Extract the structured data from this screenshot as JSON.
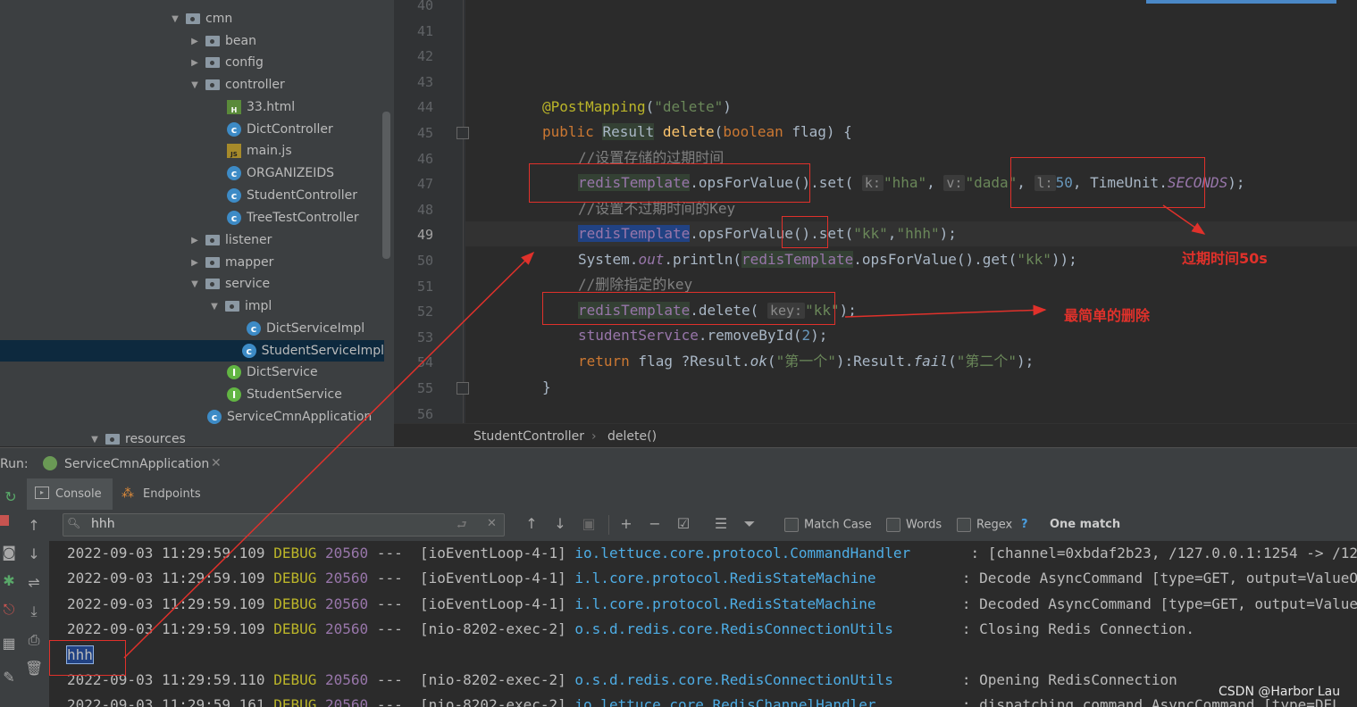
{
  "tree": {
    "items": [
      {
        "label": "cmn",
        "type": "folder",
        "expanded": true
      },
      {
        "label": "bean",
        "type": "folder",
        "expanded": false
      },
      {
        "label": "config",
        "type": "folder",
        "expanded": false
      },
      {
        "label": "controller",
        "type": "folder",
        "expanded": true
      },
      {
        "label": "33.html",
        "type": "html"
      },
      {
        "label": "DictController",
        "type": "class"
      },
      {
        "label": "main.js",
        "type": "js"
      },
      {
        "label": "ORGANIZEIDS",
        "type": "class"
      },
      {
        "label": "StudentController",
        "type": "class"
      },
      {
        "label": "TreeTestController",
        "type": "class"
      },
      {
        "label": "listener",
        "type": "folder",
        "expanded": false
      },
      {
        "label": "mapper",
        "type": "folder",
        "expanded": false
      },
      {
        "label": "service",
        "type": "folder",
        "expanded": true
      },
      {
        "label": "impl",
        "type": "folder",
        "expanded": true
      },
      {
        "label": "DictServiceImpl",
        "type": "class"
      },
      {
        "label": "StudentServiceImpl",
        "type": "class",
        "selected": true
      },
      {
        "label": "DictService",
        "type": "interface"
      },
      {
        "label": "StudentService",
        "type": "interface"
      },
      {
        "label": "ServiceCmnApplication",
        "type": "app"
      },
      {
        "label": "resources",
        "type": "folder",
        "expanded": true
      }
    ]
  },
  "editor": {
    "line_numbers": [
      "40",
      "41",
      "42",
      "43",
      "44",
      "45",
      "46",
      "47",
      "48",
      "49",
      "50",
      "51",
      "52",
      "53",
      "54",
      "55",
      "56"
    ],
    "current_line": "49",
    "code": {
      "l44_ann": "@PostMapping",
      "l44_p1": "(",
      "l44_str": "\"delete\"",
      "l44_p2": ")",
      "l45_kw1": "public ",
      "l45_type": "Result",
      "l45_sp": " ",
      "l45_fn": "delete",
      "l45_p1": "(",
      "l45_kw2": "boolean",
      "l45_rest": " flag) {",
      "l46": "//设置存储的过期时间",
      "l47_obj": "redisTemplate",
      "l47_m": ".opsForValue().set(",
      "l47_h1": "k:",
      "l47_s1": "\"hha\"",
      "l47_c1": ", ",
      "l47_h2": "v:",
      "l47_s2": "\"dada\"",
      "l47_c2": ", ",
      "l47_h3": "l:",
      "l47_n": "50",
      "l47_t": ", TimeUnit.",
      "l47_f": "SECONDS",
      "l47_end": ");",
      "l48": "//设置不过期时间的Key",
      "l49_obj": "redisTemplate",
      "l49_m": ".opsForValue()",
      "l49_set": ".set(",
      "l49_s1": "\"kk\"",
      "l49_c": ",",
      "l49_s2": "\"hhh\"",
      "l49_end": ");",
      "l50_a": "System.",
      "l50_out": "out",
      "l50_b": ".println(",
      "l50_obj": "redisTemplate",
      "l50_c": ".opsForValue().get(",
      "l50_s": "\"kk\"",
      "l50_end": "));",
      "l51": "//删除指定的key",
      "l52_obj": "redisTemplate",
      "l52_m": ".delete(",
      "l52_h": "key:",
      "l52_s": "\"kk\"",
      "l52_end": ");",
      "l53_f": "studentService",
      "l53_m": ".removeById(",
      "l53_n": "2",
      "l53_end": ");",
      "l54_kw": "return",
      "l54_a": " flag ?Result.",
      "l54_ok": "ok",
      "l54_p1": "(",
      "l54_s1": "\"第一个\"",
      "l54_b": "):Result.",
      "l54_fail": "fail",
      "l54_p2": "(",
      "l54_s2": "\"第二个\"",
      "l54_end": ");",
      "l55": "}"
    }
  },
  "breadcrumb": {
    "items": [
      "StudentController",
      "delete()"
    ],
    "sep": "›"
  },
  "run": {
    "label": "Run:",
    "config": "ServiceCmnApplication",
    "tabs": [
      "Console",
      "Endpoints"
    ]
  },
  "find": {
    "query": "hhh",
    "options": [
      "Match Case",
      "Words",
      "Regex"
    ],
    "help": "?",
    "result": "One match"
  },
  "console": {
    "lines": [
      {
        "ts": "2022-09-03 11:29:59.109",
        "level": "DEBUG",
        "pid": "20560",
        "sep": " --- ",
        "thread": "[ioEventLoop-4-1]",
        "logger": "io.lettuce.core.protocol.CommandHandler   ",
        "msg": "   : [channel=0xbdaf2b23, /127.0.0.1:1254 -> /127"
      },
      {
        "ts": "2022-09-03 11:29:59.109",
        "level": "DEBUG",
        "pid": "20560",
        "sep": " --- ",
        "thread": "[ioEventLoop-4-1]",
        "logger": "i.l.core.protocol.RedisStateMachine      ",
        "msg": "   : Decode AsyncCommand [type=GET, output=ValueO"
      },
      {
        "ts": "2022-09-03 11:29:59.109",
        "level": "DEBUG",
        "pid": "20560",
        "sep": " --- ",
        "thread": "[ioEventLoop-4-1]",
        "logger": "i.l.core.protocol.RedisStateMachine      ",
        "msg": "   : Decoded AsyncCommand [type=GET, output=Value"
      },
      {
        "ts": "2022-09-03 11:29:59.109",
        "level": "DEBUG",
        "pid": "20560",
        "sep": " --- ",
        "thread": "[nio-8202-exec-2]",
        "logger": "o.s.d.redis.core.RedisConnectionUtils    ",
        "msg": "   : Closing Redis Connection."
      },
      {
        "plain": "hhh"
      },
      {
        "ts": "2022-09-03 11:29:59.110",
        "level": "DEBUG",
        "pid": "20560",
        "sep": " --- ",
        "thread": "[nio-8202-exec-2]",
        "logger": "o.s.d.redis.core.RedisConnectionUtils    ",
        "msg": "   : Opening RedisConnection"
      },
      {
        "ts": "2022-09-03 11:29:59.161",
        "level": "DEBUG",
        "pid": "20560",
        "sep": " --- ",
        "thread": "[nio-8202-exec-2]",
        "logger": "io.lettuce.core.RedisChannelHandler      ",
        "msg": "   : dispatching command AsyncCommand [type=DEL"
      }
    ]
  },
  "annotations": {
    "expire": "过期时间50s",
    "delete": "最简单的删除"
  },
  "watermark": "CSDN @Harbor Lau",
  "colors": {
    "annotation": "#e0312b",
    "accent": "#4a88c7",
    "selection": "#214283"
  }
}
